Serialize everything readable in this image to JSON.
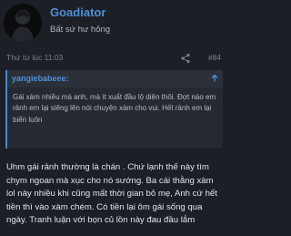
{
  "post": {
    "author": "Goadiator",
    "user_title": "Bất sứ hư hỏng",
    "timestamp": "Thứ tư lúc 11:03",
    "post_number": "#84",
    "share_icon": "share-icon",
    "quote": {
      "author": "yangiebabeee:",
      "text": "Gái xàm nhiều mà anh, mà ít xuất đầu lộ diện thôi. Đợt nào em rảnh em lại siêng lên nói chuyện xàm cho vui. Hết rảnh em lại biến luôn",
      "expand_icon": "chevron-up-icon"
    },
    "body": "Uhm gái rảnh thường là chán . Chứ lạnh thế này tìm chym ngoan mà xục cho nó sướng. Ba cái thằng xàm lol này nhiều khi cũng mất thời gian bỏ mẹ, Anh cứ hết tiền thì vào xàm chém. Có tiền lại ôm gái sống qua ngày. Tranh luận với bọn củ lồn này đau đầu lắm"
  },
  "colors": {
    "background": "#1c1f26",
    "link": "#4f8fd6",
    "quote_bg": "#252931",
    "quote_border": "#4a88cc"
  }
}
